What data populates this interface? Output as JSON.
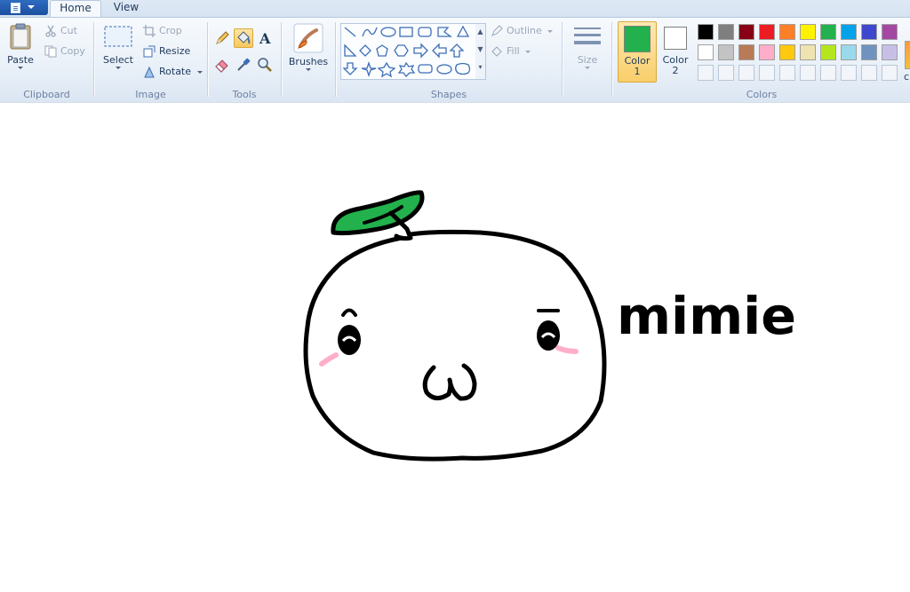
{
  "tabs": {
    "home": "Home",
    "view": "View"
  },
  "clipboard": {
    "group_label": "Clipboard",
    "paste": "Paste",
    "cut": "Cut",
    "copy": "Copy"
  },
  "image": {
    "group_label": "Image",
    "select": "Select",
    "crop": "Crop",
    "resize": "Resize",
    "rotate": "Rotate"
  },
  "tools": {
    "group_label": "Tools",
    "selected_tool": "fill"
  },
  "brushes": {
    "label": "Brushes"
  },
  "shapes": {
    "group_label": "Shapes",
    "outline": "Outline",
    "fill": "Fill"
  },
  "size": {
    "label": "Size"
  },
  "colors": {
    "group_label": "Colors",
    "color1_label": "Color",
    "color1_num": "1",
    "color1_value": "#22b14c",
    "color2_label": "Color",
    "color2_num": "2",
    "color2_value": "#ffffff",
    "palette_row1": [
      "#000000",
      "#7f7f7f",
      "#880015",
      "#ed1c24",
      "#ff7f27",
      "#fff200",
      "#22b14c",
      "#00a2e8",
      "#3f48cc",
      "#a349a4"
    ],
    "palette_row2": [
      "#ffffff",
      "#c3c3c3",
      "#b97a57",
      "#ffaec9",
      "#ffc90e",
      "#efe4b0",
      "#b5e61d",
      "#99d9ea",
      "#7092be",
      "#c8bfe7"
    ],
    "edit_colors_label": "c"
  },
  "drawing": {
    "text": "mimie"
  }
}
